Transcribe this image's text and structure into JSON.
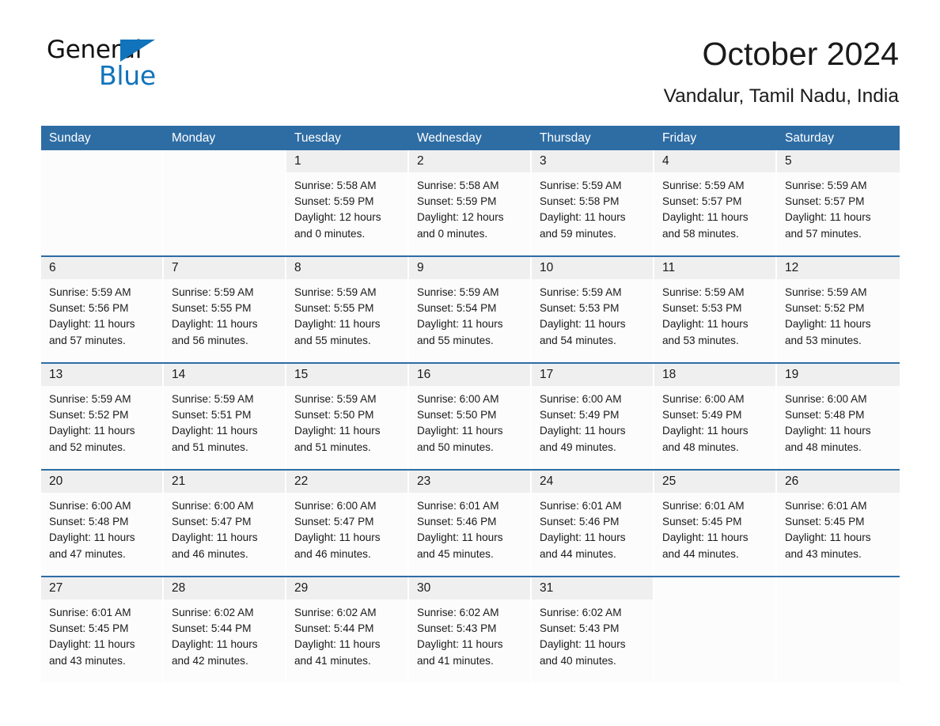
{
  "brand": {
    "name_part1": "General",
    "name_part2": "Blue",
    "triangle_color": "#1073bb",
    "logo_icon": "general-blue-triangle-logo"
  },
  "header": {
    "month_title": "October 2024",
    "location": "Vandalur, Tamil Nadu, India"
  },
  "theme": {
    "header_blue": "#2e6da4",
    "daynum_bg": "#efefef",
    "cell_bg": "#fcfcfc"
  },
  "weekday_headers": [
    "Sunday",
    "Monday",
    "Tuesday",
    "Wednesday",
    "Thursday",
    "Friday",
    "Saturday"
  ],
  "weeks": [
    [
      {
        "day": "",
        "sunrise": "",
        "sunset": "",
        "daylight_line1": "",
        "daylight_line2": "",
        "blank": true
      },
      {
        "day": "",
        "sunrise": "",
        "sunset": "",
        "daylight_line1": "",
        "daylight_line2": "",
        "blank": true
      },
      {
        "day": "1",
        "sunrise": "Sunrise: 5:58 AM",
        "sunset": "Sunset: 5:59 PM",
        "daylight_line1": "Daylight: 12 hours",
        "daylight_line2": "and 0 minutes."
      },
      {
        "day": "2",
        "sunrise": "Sunrise: 5:58 AM",
        "sunset": "Sunset: 5:59 PM",
        "daylight_line1": "Daylight: 12 hours",
        "daylight_line2": "and 0 minutes."
      },
      {
        "day": "3",
        "sunrise": "Sunrise: 5:59 AM",
        "sunset": "Sunset: 5:58 PM",
        "daylight_line1": "Daylight: 11 hours",
        "daylight_line2": "and 59 minutes."
      },
      {
        "day": "4",
        "sunrise": "Sunrise: 5:59 AM",
        "sunset": "Sunset: 5:57 PM",
        "daylight_line1": "Daylight: 11 hours",
        "daylight_line2": "and 58 minutes."
      },
      {
        "day": "5",
        "sunrise": "Sunrise: 5:59 AM",
        "sunset": "Sunset: 5:57 PM",
        "daylight_line1": "Daylight: 11 hours",
        "daylight_line2": "and 57 minutes."
      }
    ],
    [
      {
        "day": "6",
        "sunrise": "Sunrise: 5:59 AM",
        "sunset": "Sunset: 5:56 PM",
        "daylight_line1": "Daylight: 11 hours",
        "daylight_line2": "and 57 minutes."
      },
      {
        "day": "7",
        "sunrise": "Sunrise: 5:59 AM",
        "sunset": "Sunset: 5:55 PM",
        "daylight_line1": "Daylight: 11 hours",
        "daylight_line2": "and 56 minutes."
      },
      {
        "day": "8",
        "sunrise": "Sunrise: 5:59 AM",
        "sunset": "Sunset: 5:55 PM",
        "daylight_line1": "Daylight: 11 hours",
        "daylight_line2": "and 55 minutes."
      },
      {
        "day": "9",
        "sunrise": "Sunrise: 5:59 AM",
        "sunset": "Sunset: 5:54 PM",
        "daylight_line1": "Daylight: 11 hours",
        "daylight_line2": "and 55 minutes."
      },
      {
        "day": "10",
        "sunrise": "Sunrise: 5:59 AM",
        "sunset": "Sunset: 5:53 PM",
        "daylight_line1": "Daylight: 11 hours",
        "daylight_line2": "and 54 minutes."
      },
      {
        "day": "11",
        "sunrise": "Sunrise: 5:59 AM",
        "sunset": "Sunset: 5:53 PM",
        "daylight_line1": "Daylight: 11 hours",
        "daylight_line2": "and 53 minutes."
      },
      {
        "day": "12",
        "sunrise": "Sunrise: 5:59 AM",
        "sunset": "Sunset: 5:52 PM",
        "daylight_line1": "Daylight: 11 hours",
        "daylight_line2": "and 53 minutes."
      }
    ],
    [
      {
        "day": "13",
        "sunrise": "Sunrise: 5:59 AM",
        "sunset": "Sunset: 5:52 PM",
        "daylight_line1": "Daylight: 11 hours",
        "daylight_line2": "and 52 minutes."
      },
      {
        "day": "14",
        "sunrise": "Sunrise: 5:59 AM",
        "sunset": "Sunset: 5:51 PM",
        "daylight_line1": "Daylight: 11 hours",
        "daylight_line2": "and 51 minutes."
      },
      {
        "day": "15",
        "sunrise": "Sunrise: 5:59 AM",
        "sunset": "Sunset: 5:50 PM",
        "daylight_line1": "Daylight: 11 hours",
        "daylight_line2": "and 51 minutes."
      },
      {
        "day": "16",
        "sunrise": "Sunrise: 6:00 AM",
        "sunset": "Sunset: 5:50 PM",
        "daylight_line1": "Daylight: 11 hours",
        "daylight_line2": "and 50 minutes."
      },
      {
        "day": "17",
        "sunrise": "Sunrise: 6:00 AM",
        "sunset": "Sunset: 5:49 PM",
        "daylight_line1": "Daylight: 11 hours",
        "daylight_line2": "and 49 minutes."
      },
      {
        "day": "18",
        "sunrise": "Sunrise: 6:00 AM",
        "sunset": "Sunset: 5:49 PM",
        "daylight_line1": "Daylight: 11 hours",
        "daylight_line2": "and 48 minutes."
      },
      {
        "day": "19",
        "sunrise": "Sunrise: 6:00 AM",
        "sunset": "Sunset: 5:48 PM",
        "daylight_line1": "Daylight: 11 hours",
        "daylight_line2": "and 48 minutes."
      }
    ],
    [
      {
        "day": "20",
        "sunrise": "Sunrise: 6:00 AM",
        "sunset": "Sunset: 5:48 PM",
        "daylight_line1": "Daylight: 11 hours",
        "daylight_line2": "and 47 minutes."
      },
      {
        "day": "21",
        "sunrise": "Sunrise: 6:00 AM",
        "sunset": "Sunset: 5:47 PM",
        "daylight_line1": "Daylight: 11 hours",
        "daylight_line2": "and 46 minutes."
      },
      {
        "day": "22",
        "sunrise": "Sunrise: 6:00 AM",
        "sunset": "Sunset: 5:47 PM",
        "daylight_line1": "Daylight: 11 hours",
        "daylight_line2": "and 46 minutes."
      },
      {
        "day": "23",
        "sunrise": "Sunrise: 6:01 AM",
        "sunset": "Sunset: 5:46 PM",
        "daylight_line1": "Daylight: 11 hours",
        "daylight_line2": "and 45 minutes."
      },
      {
        "day": "24",
        "sunrise": "Sunrise: 6:01 AM",
        "sunset": "Sunset: 5:46 PM",
        "daylight_line1": "Daylight: 11 hours",
        "daylight_line2": "and 44 minutes."
      },
      {
        "day": "25",
        "sunrise": "Sunrise: 6:01 AM",
        "sunset": "Sunset: 5:45 PM",
        "daylight_line1": "Daylight: 11 hours",
        "daylight_line2": "and 44 minutes."
      },
      {
        "day": "26",
        "sunrise": "Sunrise: 6:01 AM",
        "sunset": "Sunset: 5:45 PM",
        "daylight_line1": "Daylight: 11 hours",
        "daylight_line2": "and 43 minutes."
      }
    ],
    [
      {
        "day": "27",
        "sunrise": "Sunrise: 6:01 AM",
        "sunset": "Sunset: 5:45 PM",
        "daylight_line1": "Daylight: 11 hours",
        "daylight_line2": "and 43 minutes."
      },
      {
        "day": "28",
        "sunrise": "Sunrise: 6:02 AM",
        "sunset": "Sunset: 5:44 PM",
        "daylight_line1": "Daylight: 11 hours",
        "daylight_line2": "and 42 minutes."
      },
      {
        "day": "29",
        "sunrise": "Sunrise: 6:02 AM",
        "sunset": "Sunset: 5:44 PM",
        "daylight_line1": "Daylight: 11 hours",
        "daylight_line2": "and 41 minutes."
      },
      {
        "day": "30",
        "sunrise": "Sunrise: 6:02 AM",
        "sunset": "Sunset: 5:43 PM",
        "daylight_line1": "Daylight: 11 hours",
        "daylight_line2": "and 41 minutes."
      },
      {
        "day": "31",
        "sunrise": "Sunrise: 6:02 AM",
        "sunset": "Sunset: 5:43 PM",
        "daylight_line1": "Daylight: 11 hours",
        "daylight_line2": "and 40 minutes."
      },
      {
        "day": "",
        "sunrise": "",
        "sunset": "",
        "daylight_line1": "",
        "daylight_line2": "",
        "blank": true
      },
      {
        "day": "",
        "sunrise": "",
        "sunset": "",
        "daylight_line1": "",
        "daylight_line2": "",
        "blank": true
      }
    ]
  ]
}
